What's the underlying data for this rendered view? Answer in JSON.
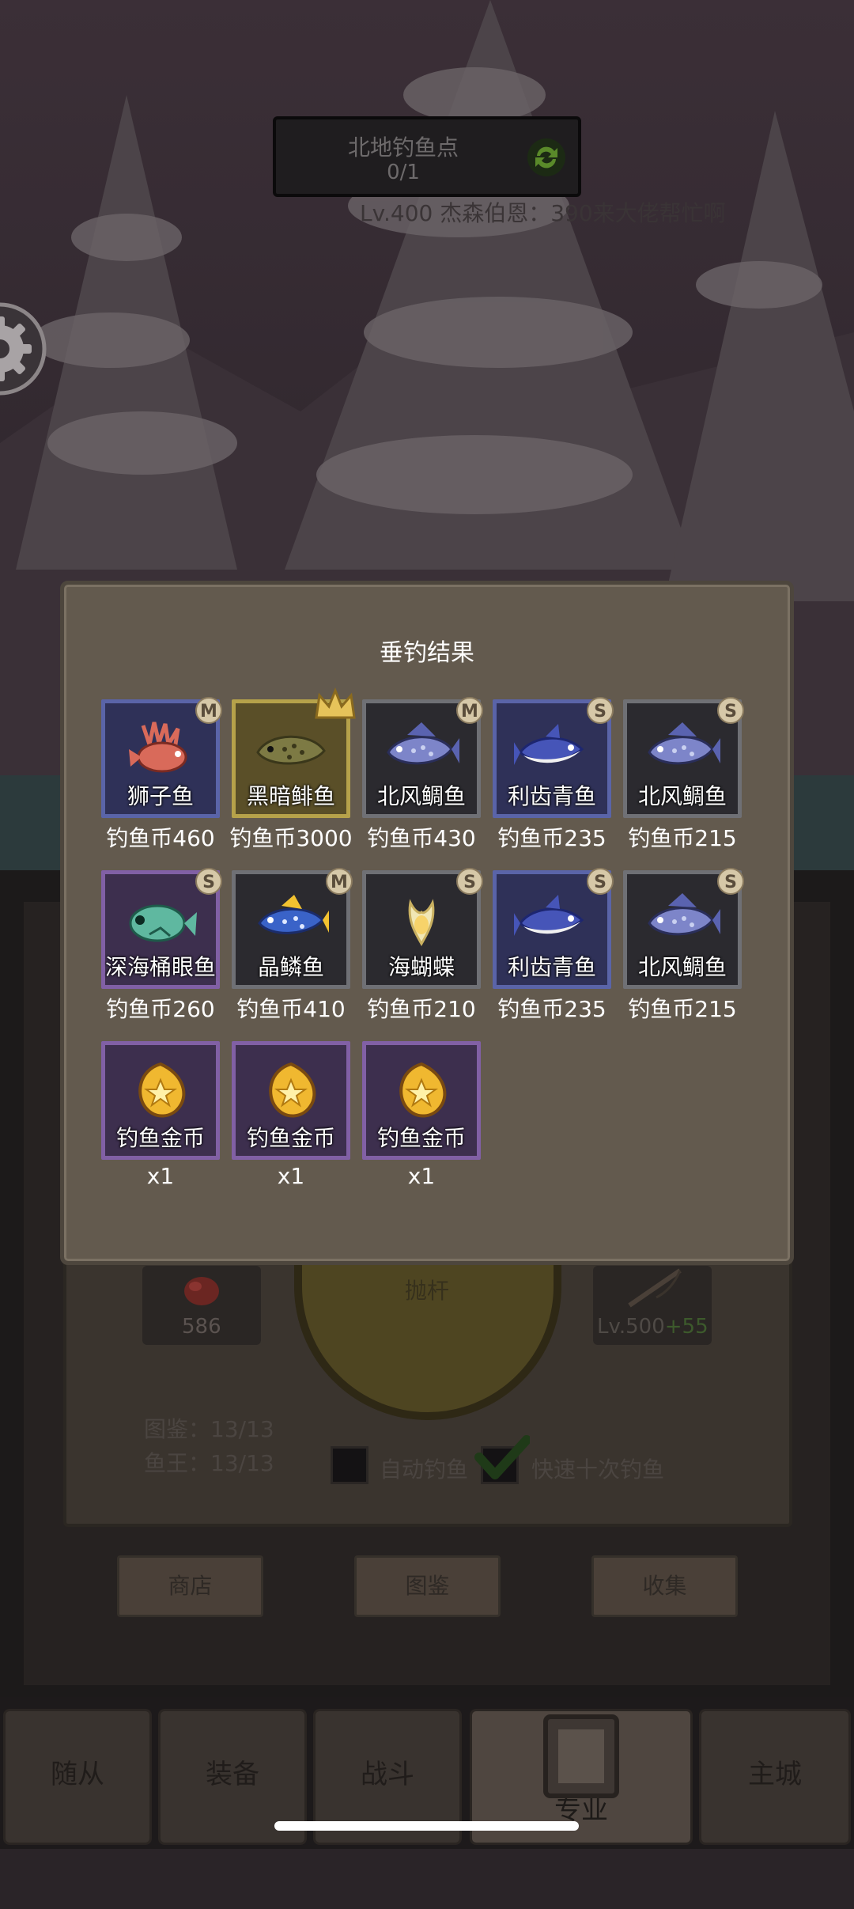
{
  "location": {
    "name": "北地钓鱼点",
    "progress": "0/1",
    "notice": "Lv.400 杰森伯恩：390来大佬帮忙啊"
  },
  "back_panel": {
    "bait_count": "586",
    "cast_label": "抛杆",
    "rod_level": "Lv.500",
    "rod_bonus": "+55",
    "catalog_stat": "图鉴：13/13",
    "king_stat": "鱼王：13/13",
    "auto_fish_label": "自动钓鱼",
    "auto_fish_checked": false,
    "fast_ten_label": "快速十次钓鱼",
    "fast_ten_checked": true,
    "buttons": [
      "商店",
      "图鉴",
      "收集"
    ]
  },
  "nav": {
    "tabs": [
      "随从",
      "装备",
      "战斗",
      "专业",
      "主城"
    ],
    "active": "专业"
  },
  "dialog": {
    "title": "垂钓结果",
    "items": [
      {
        "name": "狮子鱼",
        "price": "钓鱼币460",
        "badge": "M",
        "frame": "blue",
        "icon": "lionfish-icon",
        "color": "#d96a5a"
      },
      {
        "name": "黑暗鲱鱼",
        "price": "钓鱼币3000",
        "badge": "crown",
        "frame": "gold",
        "icon": "dark-herring-icon",
        "color": "#7d7a44"
      },
      {
        "name": "北风鲷鱼",
        "price": "钓鱼币430",
        "badge": "M",
        "frame": "grey",
        "icon": "snapper-icon",
        "color": "#7d85c9"
      },
      {
        "name": "利齿青鱼",
        "price": "钓鱼币235",
        "badge": "S",
        "frame": "blue",
        "icon": "tuna-icon",
        "color": "#4655b8"
      },
      {
        "name": "北风鲷鱼",
        "price": "钓鱼币215",
        "badge": "S",
        "frame": "grey",
        "icon": "snapper-icon",
        "color": "#7d85c9"
      },
      {
        "name": "深海桶眼鱼",
        "price": "钓鱼币260",
        "badge": "S",
        "frame": "purple",
        "icon": "barreleye-icon",
        "color": "#5fb8a0"
      },
      {
        "name": "晶鳞鱼",
        "price": "钓鱼币410",
        "badge": "M",
        "frame": "grey",
        "icon": "crystal-fish-icon",
        "color": "#3a63c8"
      },
      {
        "name": "海蝴蝶",
        "price": "钓鱼币210",
        "badge": "S",
        "frame": "grey",
        "icon": "sea-butterfly-icon",
        "color": "#f1e7b5"
      },
      {
        "name": "利齿青鱼",
        "price": "钓鱼币235",
        "badge": "S",
        "frame": "blue",
        "icon": "tuna-icon",
        "color": "#4655b8"
      },
      {
        "name": "北风鲷鱼",
        "price": "钓鱼币215",
        "badge": "S",
        "frame": "grey",
        "icon": "snapper-icon",
        "color": "#7d85c9"
      },
      {
        "name": "钓鱼金币",
        "price": "x1",
        "badge": "",
        "frame": "purple",
        "icon": "gold-coin-icon",
        "color": "#f0b830"
      },
      {
        "name": "钓鱼金币",
        "price": "x1",
        "badge": "",
        "frame": "purple",
        "icon": "gold-coin-icon",
        "color": "#f0b830"
      },
      {
        "name": "钓鱼金币",
        "price": "x1",
        "badge": "",
        "frame": "purple",
        "icon": "gold-coin-icon",
        "color": "#f0b830"
      }
    ]
  }
}
